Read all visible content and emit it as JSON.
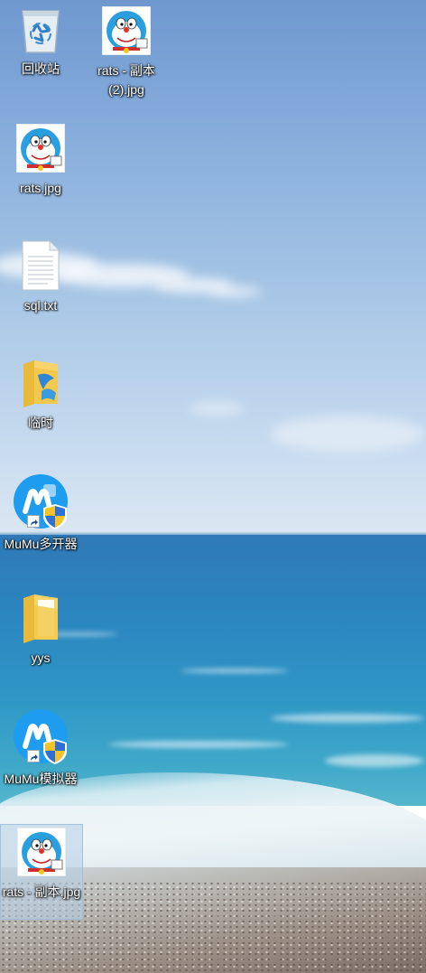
{
  "desktop": {
    "icons": [
      {
        "label": "回收站",
        "icon": "recycle-bin-icon"
      },
      {
        "label": "rats - 副本 (2).jpg",
        "icon": "image-thumbnail-icon"
      },
      {
        "label": "rats.jpg",
        "icon": "image-thumbnail-icon"
      },
      {
        "label": "sql.txt",
        "icon": "text-file-icon"
      },
      {
        "label": "临时",
        "icon": "folder-icon"
      },
      {
        "label": "MuMu多开器",
        "icon": "mumu-app-icon",
        "shortcut": true
      },
      {
        "label": "yys",
        "icon": "folder-icon"
      },
      {
        "label": "MuMu模拟器",
        "icon": "mumu-app-icon",
        "shortcut": true
      },
      {
        "label": "rats - 副本.jpg",
        "icon": "image-thumbnail-icon",
        "selected": true
      }
    ]
  },
  "colors": {
    "selection": "#b4cde6",
    "mumu_blue": "#1e9cf0",
    "folder_yellow": "#f2c94c"
  }
}
